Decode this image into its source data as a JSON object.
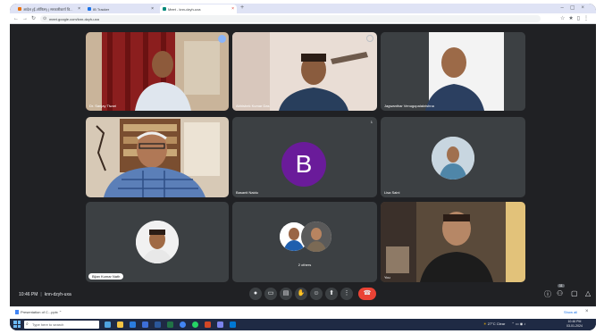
{
  "browser": {
    "tabs": [
      {
        "label": "आदेश (ई-ऑफिस) | सरकारीकार्य वि..."
      },
      {
        "label": "IB Tracker"
      },
      {
        "label": "Meet - knn-dzyh-uxa"
      }
    ],
    "url": "meet.google.com/knn-dzyh-uxa"
  },
  "meeting": {
    "time": "10:46 PM",
    "code": "knn-dzyh-uxa",
    "participants": [
      {
        "name": "Dr. Sanjay Tiwari"
      },
      {
        "name": "Abhishek Kumar Das"
      },
      {
        "name": "Jagwanthar Venugopalakrishna"
      },
      {
        "name": ""
      },
      {
        "name": "Basanti Naidu",
        "initial": "B"
      },
      {
        "name": "Lisa Saini"
      },
      {
        "name": "Bijan Kumar Nath"
      },
      {
        "name": "2 others"
      },
      {
        "name": "You"
      }
    ],
    "tile5_count": "1",
    "people_count": "11",
    "colors": {
      "leave": "#ea4335",
      "avatar_b": "#6a1b9a",
      "accent": "#8ab4f8"
    }
  },
  "downloads": {
    "file": "Presentation of C...pptx",
    "show_all": "Show all"
  },
  "taskbar": {
    "search_placeholder": "Type here to search",
    "weather": "27°C  Clear",
    "clock_time": "10:46 PM",
    "clock_date": "03-01-2024"
  }
}
